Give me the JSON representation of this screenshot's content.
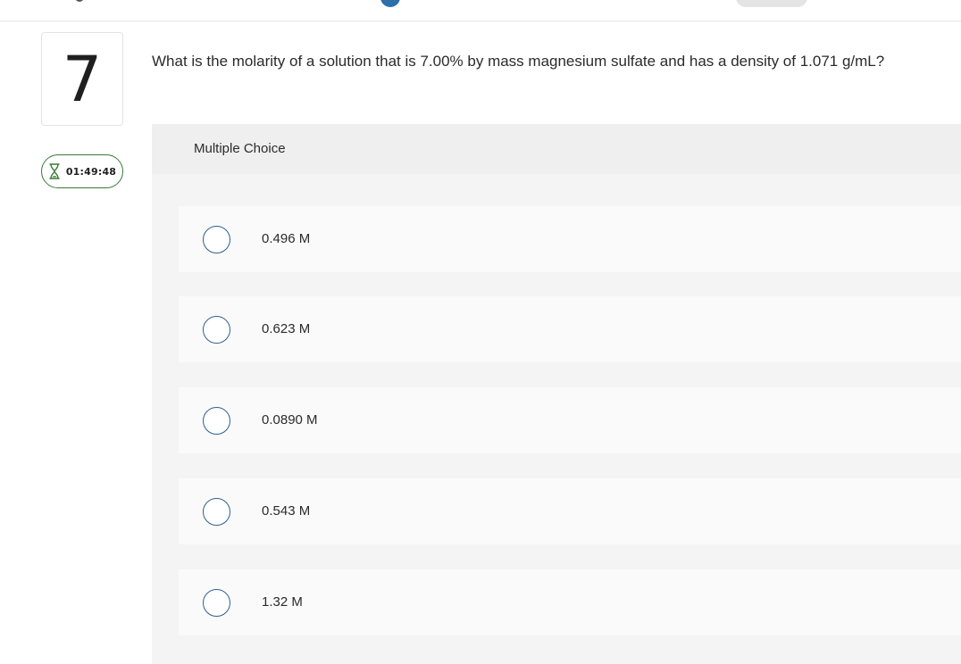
{
  "question": {
    "number": "7",
    "timer": "01:49:48",
    "prompt": "What is the molarity of a solution that is 7.00% by mass magnesium sulfate and has a density of 1.071 g/mL?",
    "type_label": "Multiple Choice",
    "options": [
      {
        "label": "0.496 M"
      },
      {
        "label": "0.623 M"
      },
      {
        "label": "0.0890 M"
      },
      {
        "label": "0.543 M"
      },
      {
        "label": "1.32 M"
      }
    ]
  },
  "colors": {
    "timer_border": "#3a7a3a",
    "radio_border": "#2f5f8f",
    "topbar_accent": "#2d6fa8"
  },
  "icons": {
    "timer": "hourglass-icon"
  }
}
